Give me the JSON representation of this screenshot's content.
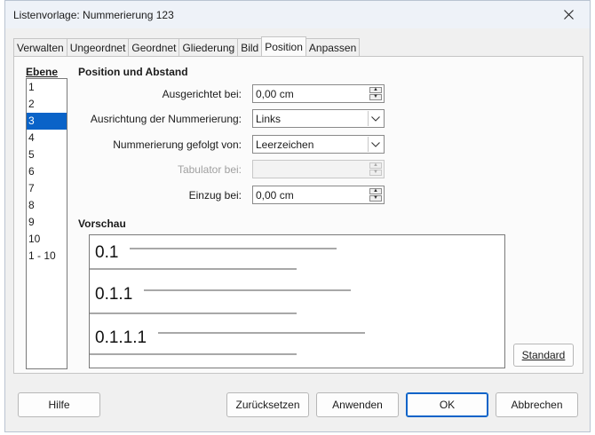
{
  "window": {
    "title": "Listenvorlage: Nummerierung 123"
  },
  "tabs": [
    {
      "label": "Verwalten",
      "active": false
    },
    {
      "label": "Ungeordnet",
      "active": false
    },
    {
      "label": "Geordnet",
      "active": false
    },
    {
      "label": "Gliederung",
      "active": false
    },
    {
      "label": "Bild",
      "active": false
    },
    {
      "label": "Position",
      "active": true
    },
    {
      "label": "Anpassen",
      "active": false
    }
  ],
  "levels": {
    "header": "Ebene",
    "items": [
      "1",
      "2",
      "3",
      "4",
      "5",
      "6",
      "7",
      "8",
      "9",
      "10",
      "1 - 10"
    ],
    "selected": "3"
  },
  "position": {
    "section_title": "Position und Abstand",
    "aligned_at_label": "Ausgerichtet bei:",
    "aligned_at_value": "0,00 cm",
    "alignment_label": "Ausrichtung der Nummerierung:",
    "alignment_value": "Links",
    "followed_by_label": "Nummerierung gefolgt von:",
    "followed_by_value": "Leerzeichen",
    "tab_stop_label": "Tabulator bei:",
    "tab_stop_value": "",
    "indent_label": "Einzug bei:",
    "indent_value": "0,00 cm"
  },
  "preview": {
    "title": "Vorschau",
    "items": [
      "0.1",
      "0.1.1",
      "0.1.1.1"
    ]
  },
  "buttons": {
    "standard": "Standard",
    "help": "Hilfe",
    "reset": "Zurücksetzen",
    "apply": "Anwenden",
    "ok": "OK",
    "cancel": "Abbrechen"
  },
  "icons": {
    "close": "close-icon",
    "spin_up": "spin-up-icon",
    "spin_down": "spin-down-icon",
    "dropdown": "chevron-down-icon"
  }
}
